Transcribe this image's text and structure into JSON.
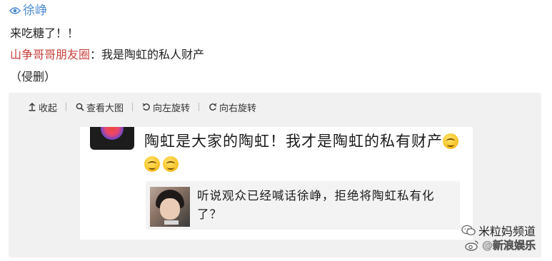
{
  "post": {
    "author": "徐峥",
    "line1": "来吃糖了！！",
    "mention": "山争哥哥朋友圈",
    "mention_rest": "：我是陶虹的私人财产",
    "line3": "（侵删）"
  },
  "toolbar": {
    "collapse_label": "收起",
    "zoom_label": "查看大图",
    "rotate_left_label": "向左旋转",
    "rotate_right_label": "向右旋转"
  },
  "image": {
    "post_text": "陶虹是大家的陶虹！我才是陶虹的私有财产",
    "quote_text": "听说观众已经喊话徐峥，拒绝将陶虹私有化了？",
    "emoji_count": 3
  },
  "watermark": {
    "line1": "米粒妈频道",
    "line2": "@新浪娱乐"
  },
  "colors": {
    "link_blue": "#4e8ccf",
    "mention_red": "#c8413c",
    "panel_bg": "#f1f1f1"
  },
  "icons": {
    "author": "eye-icon",
    "collapse": "arrow-up-icon",
    "zoom": "magnifier-icon",
    "rotate_left": "rotate-left-icon",
    "rotate_right": "rotate-right-icon",
    "wechat": "wechat-icon",
    "weibo": "weibo-icon"
  }
}
